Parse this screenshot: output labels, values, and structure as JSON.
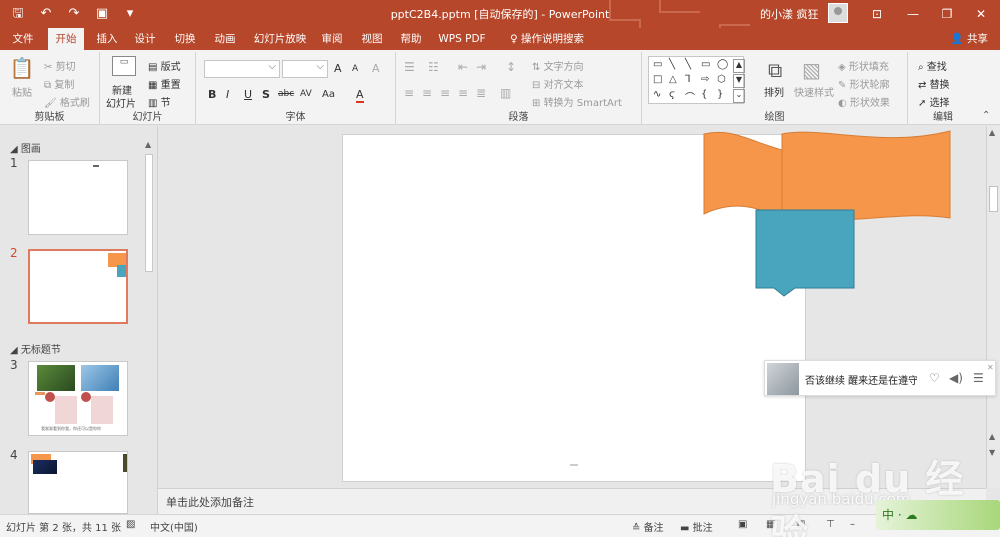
{
  "titlebar": {
    "doc_title": "pptC2B4.pptm [自动保存的]  -  PowerPoint",
    "user_name": "的小漾 疯狂",
    "qat": [
      "save-icon",
      "undo-icon",
      "redo-icon",
      "present-icon",
      "customize-icon"
    ]
  },
  "tabs": [
    "文件",
    "开始",
    "插入",
    "设计",
    "切换",
    "动画",
    "幻灯片放映",
    "审阅",
    "视图",
    "帮助",
    "WPS PDF",
    "操作说明搜索"
  ],
  "active_tab": "开始",
  "share_label": "共享",
  "ribbon": {
    "clipboard": {
      "paste": "粘贴",
      "cut": "剪切",
      "copy": "复制",
      "format_painter": "格式刷",
      "label": "剪贴板"
    },
    "slides": {
      "new_slide_line1": "新建",
      "new_slide_line2": "幻灯片",
      "layout": "版式",
      "reset": "重置",
      "section": "节",
      "label": "幻灯片"
    },
    "font": {
      "bold": "B",
      "italic": "I",
      "underline": "U",
      "shadow": "S",
      "strike": "abc",
      "spacing": "AV",
      "case": "Aa",
      "grow": "A",
      "shrink": "A",
      "clear": "A",
      "color": "A",
      "label": "字体"
    },
    "paragraph": {
      "text_direction": "文字方向",
      "align_text": "对齐文本",
      "smartart": "转换为 SmartArt",
      "label": "段落"
    },
    "drawing": {
      "arrange": "排列",
      "quick_styles": "快速样式",
      "fill": "形状填充",
      "outline": "形状轮廓",
      "effects": "形状效果",
      "label": "绘图"
    },
    "editing": {
      "find": "查找",
      "replace": "替换",
      "select": "选择",
      "label": "编辑"
    }
  },
  "thumbnails": {
    "section1": "图画",
    "section2": "无标题节",
    "slides": [
      {
        "num": "1"
      },
      {
        "num": "2"
      },
      {
        "num": "3",
        "caption": "我渐渐看到你我，你还可以是你你"
      },
      {
        "num": "4"
      }
    ]
  },
  "notes_placeholder": "单击此处添加备注",
  "status": {
    "slide_info": "幻灯片 第 2 张，共 11 张",
    "language": "中文(中国)",
    "notes": "备注",
    "comments": "批注"
  },
  "popup": {
    "text": "否该继续 醒来还是在遵守约"
  },
  "watermark": {
    "logo": "Bai du 经验",
    "url": "jingyan.baidu.com"
  },
  "ime": {
    "label": "中 · ☁"
  },
  "colors": {
    "accent": "#b7472a",
    "shape_orange": "#f5964a",
    "shape_teal": "#48a5bd",
    "selected_thumb_border": "#e07a5f"
  }
}
